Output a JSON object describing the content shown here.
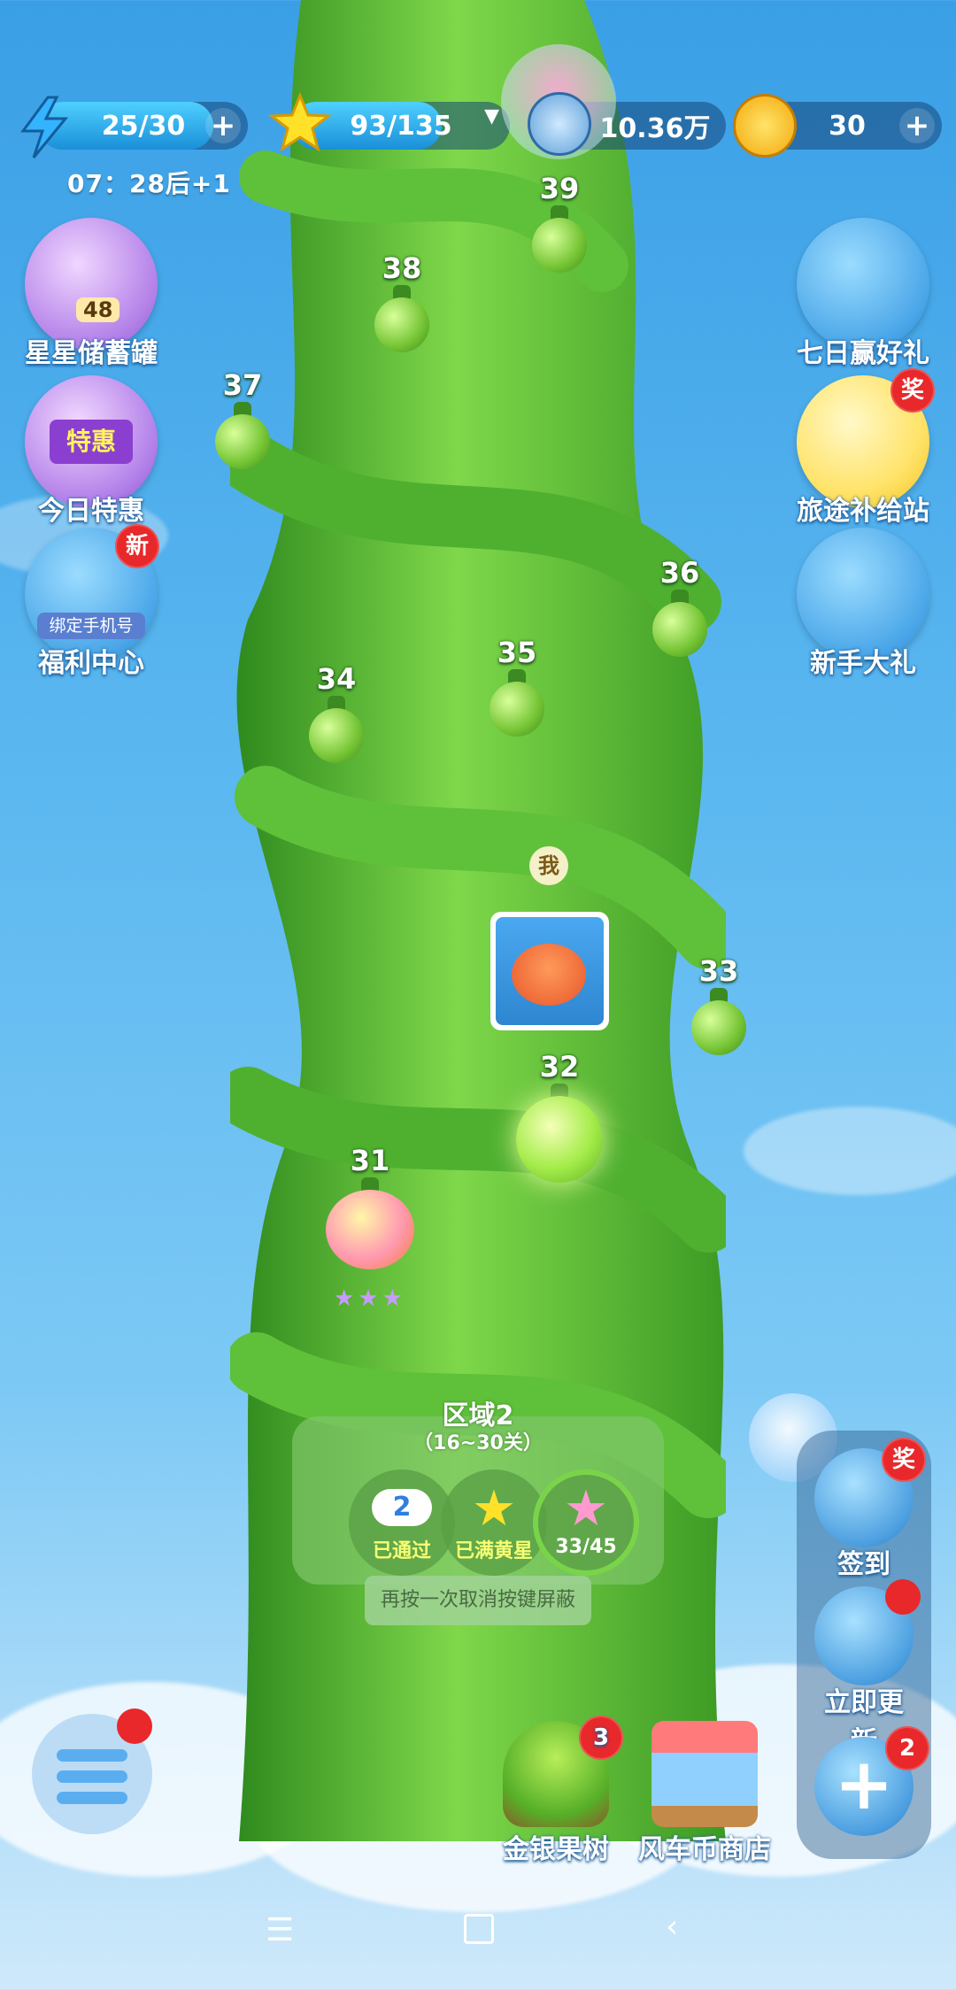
{
  "topbar": {
    "energy": {
      "value": "25/30",
      "fill": 0.8333,
      "plus": "+"
    },
    "stars": {
      "value": "93/135",
      "fill": 0.689
    },
    "windmill": {
      "value": "10.36万"
    },
    "coins": {
      "value": "30",
      "plus": "+"
    },
    "timer": "07：28后+1"
  },
  "left_buttons": [
    {
      "label": "星星储蓄罐",
      "count": "48"
    },
    {
      "label": "今日特惠",
      "sign": "特惠"
    },
    {
      "label": "福利中心",
      "badge": "新",
      "sub": "绑定手机号"
    }
  ],
  "right_buttons": [
    {
      "label": "七日赢好礼"
    },
    {
      "label": "旅途补给站",
      "badge": "奖"
    },
    {
      "label": "新手大礼"
    }
  ],
  "levels": [
    "39",
    "38",
    "37",
    "36",
    "35",
    "34",
    "33",
    "32",
    "31"
  ],
  "me_marker": "我",
  "level31_stars": 3,
  "region": {
    "title": "区域2",
    "range": "（16~30关）",
    "stats": [
      {
        "icon": "cloud-icon",
        "value": "2",
        "caption": "已通过"
      },
      {
        "icon": "star-icon",
        "caption": "已满黄星"
      },
      {
        "icon": "rainbow-star-icon",
        "caption": "33/45"
      }
    ]
  },
  "toast": "再按一次取消按键屏蔽",
  "bottom": {
    "tree": {
      "label": "金银果树",
      "badge": "3"
    },
    "shop": {
      "label": "风车币商店"
    }
  },
  "side_dock": [
    {
      "label": "签到",
      "badge": "奖"
    },
    {
      "label": "立即更新"
    },
    {
      "label": "",
      "badge": "2"
    }
  ],
  "colors": {
    "badge": "#e8282a",
    "accent_text": "#f8ff72"
  }
}
